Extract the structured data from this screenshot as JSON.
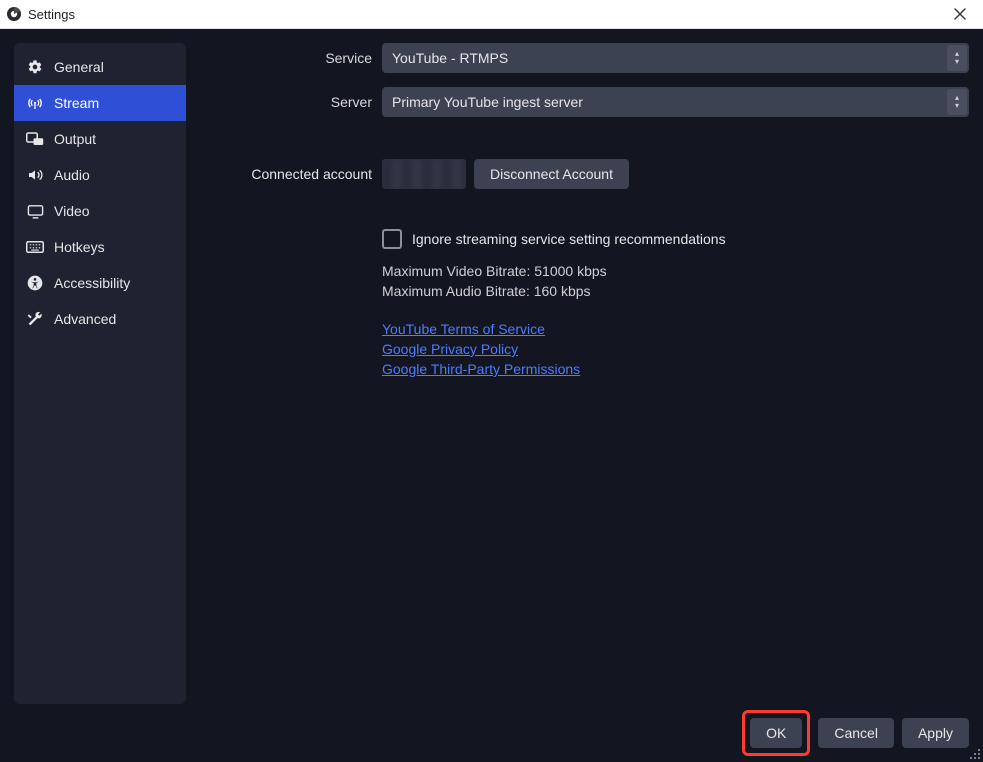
{
  "window": {
    "title": "Settings"
  },
  "sidebar": {
    "items": [
      {
        "label": "General"
      },
      {
        "label": "Stream"
      },
      {
        "label": "Output"
      },
      {
        "label": "Audio"
      },
      {
        "label": "Video"
      },
      {
        "label": "Hotkeys"
      },
      {
        "label": "Accessibility"
      },
      {
        "label": "Advanced"
      }
    ]
  },
  "form": {
    "service_label": "Service",
    "service_value": "YouTube - RTMPS",
    "server_label": "Server",
    "server_value": "Primary YouTube ingest server",
    "connected_label": "Connected account",
    "disconnect_label": "Disconnect Account",
    "ignore_label": "Ignore streaming service setting recommendations",
    "max_video": "Maximum Video Bitrate: 51000 kbps",
    "max_audio": "Maximum Audio Bitrate: 160 kbps",
    "link_tos": "YouTube Terms of Service",
    "link_privacy": "Google Privacy Policy",
    "link_thirdparty": "Google Third-Party Permissions"
  },
  "footer": {
    "ok": "OK",
    "cancel": "Cancel",
    "apply": "Apply"
  }
}
